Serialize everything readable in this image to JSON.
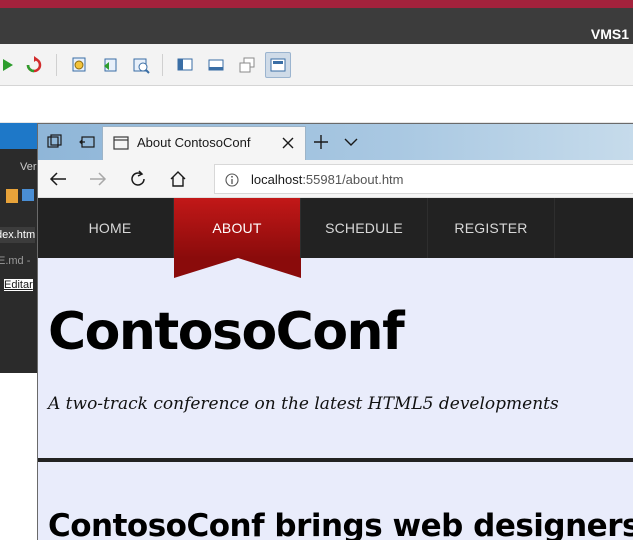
{
  "vm_window": {
    "title": "VMS1"
  },
  "vm_toolbar": {
    "buttons": [
      {
        "icon": "play-icon"
      },
      {
        "icon": "reset-icon"
      },
      {
        "icon": "checkpoint-icon"
      },
      {
        "icon": "revert-icon"
      },
      {
        "icon": "snapshot-icon"
      },
      {
        "icon": "basic-session-icon"
      },
      {
        "icon": "enhanced-session-icon"
      },
      {
        "icon": "resize-icon"
      },
      {
        "icon": "fullscreen-icon"
      }
    ],
    "active_button": "fullscreen-icon"
  },
  "vscode": {
    "menu_fragment": "Ver",
    "tab_fragment": "dex.htm",
    "file_fragment": "E.md -",
    "menu_item_fragment": "Editar"
  },
  "browser": {
    "tab": {
      "title": "About ContosoConf"
    },
    "address": {
      "host": "localhost",
      "rest": ":55981/about.htm"
    }
  },
  "site": {
    "nav": [
      "HOME",
      "ABOUT",
      "SCHEDULE",
      "REGISTER"
    ],
    "active_nav": "ABOUT",
    "title": "ContosoConf",
    "tagline": "A two-track conference on the latest HTML5 developments",
    "section_heading": "ContosoConf brings web designers an"
  },
  "colors": {
    "vm_accent": "#a3223c",
    "nav_active": "#c21818",
    "page_bg": "#e9ecfb",
    "tabbar": "#a9c8e2"
  }
}
